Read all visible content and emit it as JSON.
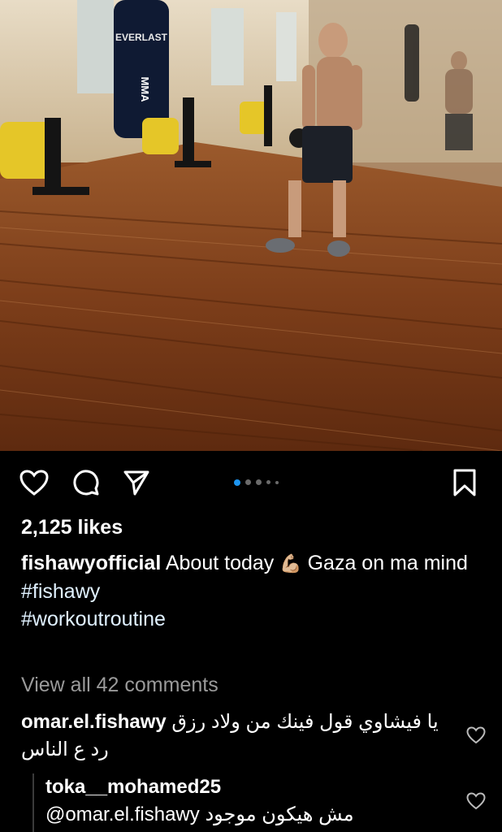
{
  "post": {
    "likes": "2,125 likes",
    "author": "fishawyofficial",
    "caption_text": "About today",
    "caption_emoji": "💪🏼",
    "caption_tail": "Gaza on ma mind",
    "hashtags": [
      "#fishawy",
      "#workoutroutine"
    ],
    "view_all_comments": "View all 42 comments",
    "carousel": {
      "count": 5,
      "active_index": 0
    }
  },
  "comments": [
    {
      "username": "omar.el.fishawy",
      "text": "يا فيشاوي قول فينك من ولاد رزق رد ع الناس"
    },
    {
      "username": "toka__mohamed25",
      "mention": "@omar.el.fishawy",
      "text": "مش هيكون موجود"
    }
  ],
  "icons": {
    "like": "heart-icon",
    "comment": "comment-bubble-icon",
    "share": "paper-plane-icon",
    "save": "bookmark-icon",
    "comment_like": "heart-outline-icon"
  },
  "colors": {
    "background": "#000000",
    "text": "#ffffff",
    "muted": "#9a9a9a",
    "carousel_active": "#1d95f0",
    "carousel_inactive": "#6b6b6b"
  }
}
